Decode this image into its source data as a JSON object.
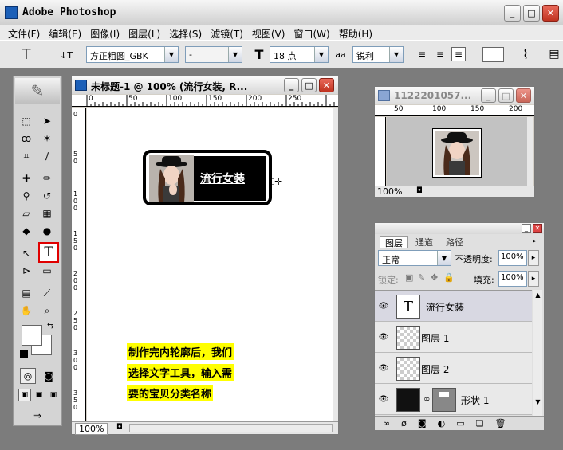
{
  "app": {
    "title": "Adobe Photoshop",
    "icon": "photoshop-feather-icon"
  },
  "window_controls": {
    "minimize": "_",
    "maximize": "□",
    "close": "✕"
  },
  "menu": [
    "文件(F)",
    "编辑(E)",
    "图像(I)",
    "图层(L)",
    "选择(S)",
    "滤镜(T)",
    "视图(V)",
    "窗口(W)",
    "帮助(H)"
  ],
  "options_bar": {
    "tool_glyph": "T",
    "orientation_glyph": "↓T",
    "font_family": "方正粗圆_GBK",
    "font_style": "-",
    "size_glyph": "T",
    "font_size": "18 点",
    "aa_glyph": "aa",
    "antialias": "锐利",
    "align": [
      "left-align-icon",
      "center-align-icon",
      "right-align-icon"
    ],
    "warp_glyph": "⌇"
  },
  "document": {
    "title": "未标题-1 @ 100% (流行女装, R...",
    "ruler_h": [
      "0",
      "50",
      "100",
      "150",
      "200",
      "250"
    ],
    "ruler_v": [
      "0",
      "5\n0",
      "1\n0\n0",
      "1\n5\n0",
      "2\n0\n0",
      "2\n5\n0",
      "3\n0\n0",
      "3\n5\n0"
    ],
    "zoom": "100%",
    "banner_text": "流行女装",
    "annotation": [
      "制作完内轮廓后，我们",
      "选择文字工具，输入需",
      "要的宝贝分类名称"
    ]
  },
  "navigator": {
    "title": "1122201057...",
    "ruler": [
      "50",
      "100",
      "150",
      "200"
    ],
    "zoom": "100%"
  },
  "layers_panel": {
    "tabs": [
      "图层",
      "通道",
      "路径"
    ],
    "blend_mode": "正常",
    "opacity_label": "不透明度:",
    "opacity": "100%",
    "lock_label": "锁定:",
    "fill_label": "填充:",
    "fill": "100%",
    "layers": [
      {
        "name": "流行女装",
        "type": "text",
        "selected": true
      },
      {
        "name": "图层 1",
        "type": "raster",
        "selected": false
      },
      {
        "name": "图层 2",
        "type": "raster",
        "selected": false
      },
      {
        "name": "形状 1",
        "type": "shape",
        "selected": false
      }
    ],
    "footer_icons": [
      "link-layers-icon",
      "layer-style-icon",
      "layer-mask-icon",
      "adjustment-layer-icon",
      "group-icon",
      "new-layer-icon",
      "delete-layer-icon"
    ]
  },
  "colors": {
    "accent": "#1b5fb8",
    "highlight": "#ffff00",
    "selected_tool_border": "#e00000"
  }
}
